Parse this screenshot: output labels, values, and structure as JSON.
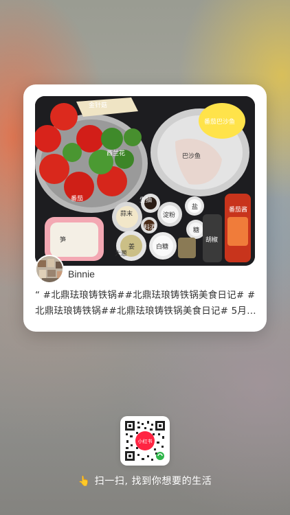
{
  "post": {
    "image_labels": {
      "enoki": "金针菇",
      "broccoli": "西兰花",
      "tomato": "番茄",
      "fish": "巴沙鱼",
      "sauce_bubble": "番茄巴沙鱼",
      "light_soy": "生抽",
      "salt": "盐",
      "starch": "淀粉",
      "garlic": "蒜末",
      "cooking_wine": "料酒",
      "sugar_small": "糖",
      "tomato_sauce": "番茄酱",
      "bamboo": "笋",
      "scallion_ginger": "姜",
      "green_onion": "大葱",
      "white_sugar": "白糖",
      "pepper": "胡椒"
    },
    "author_name": "Binnie",
    "description": "“ #北鼎珐琅铸铁锅##北鼎珐琅铸铁锅美食日记# #北鼎珐琅铸铁锅##北鼎珐琅铸铁锅美食日记# 5月…"
  },
  "qr": {
    "logo_text": "小红书"
  },
  "footer": {
    "hand_icon": "👆",
    "text": "扫一扫, 找到你想要的生活"
  },
  "colors": {
    "brand_red": "#ff2442",
    "card_bg": "#ffffff"
  }
}
